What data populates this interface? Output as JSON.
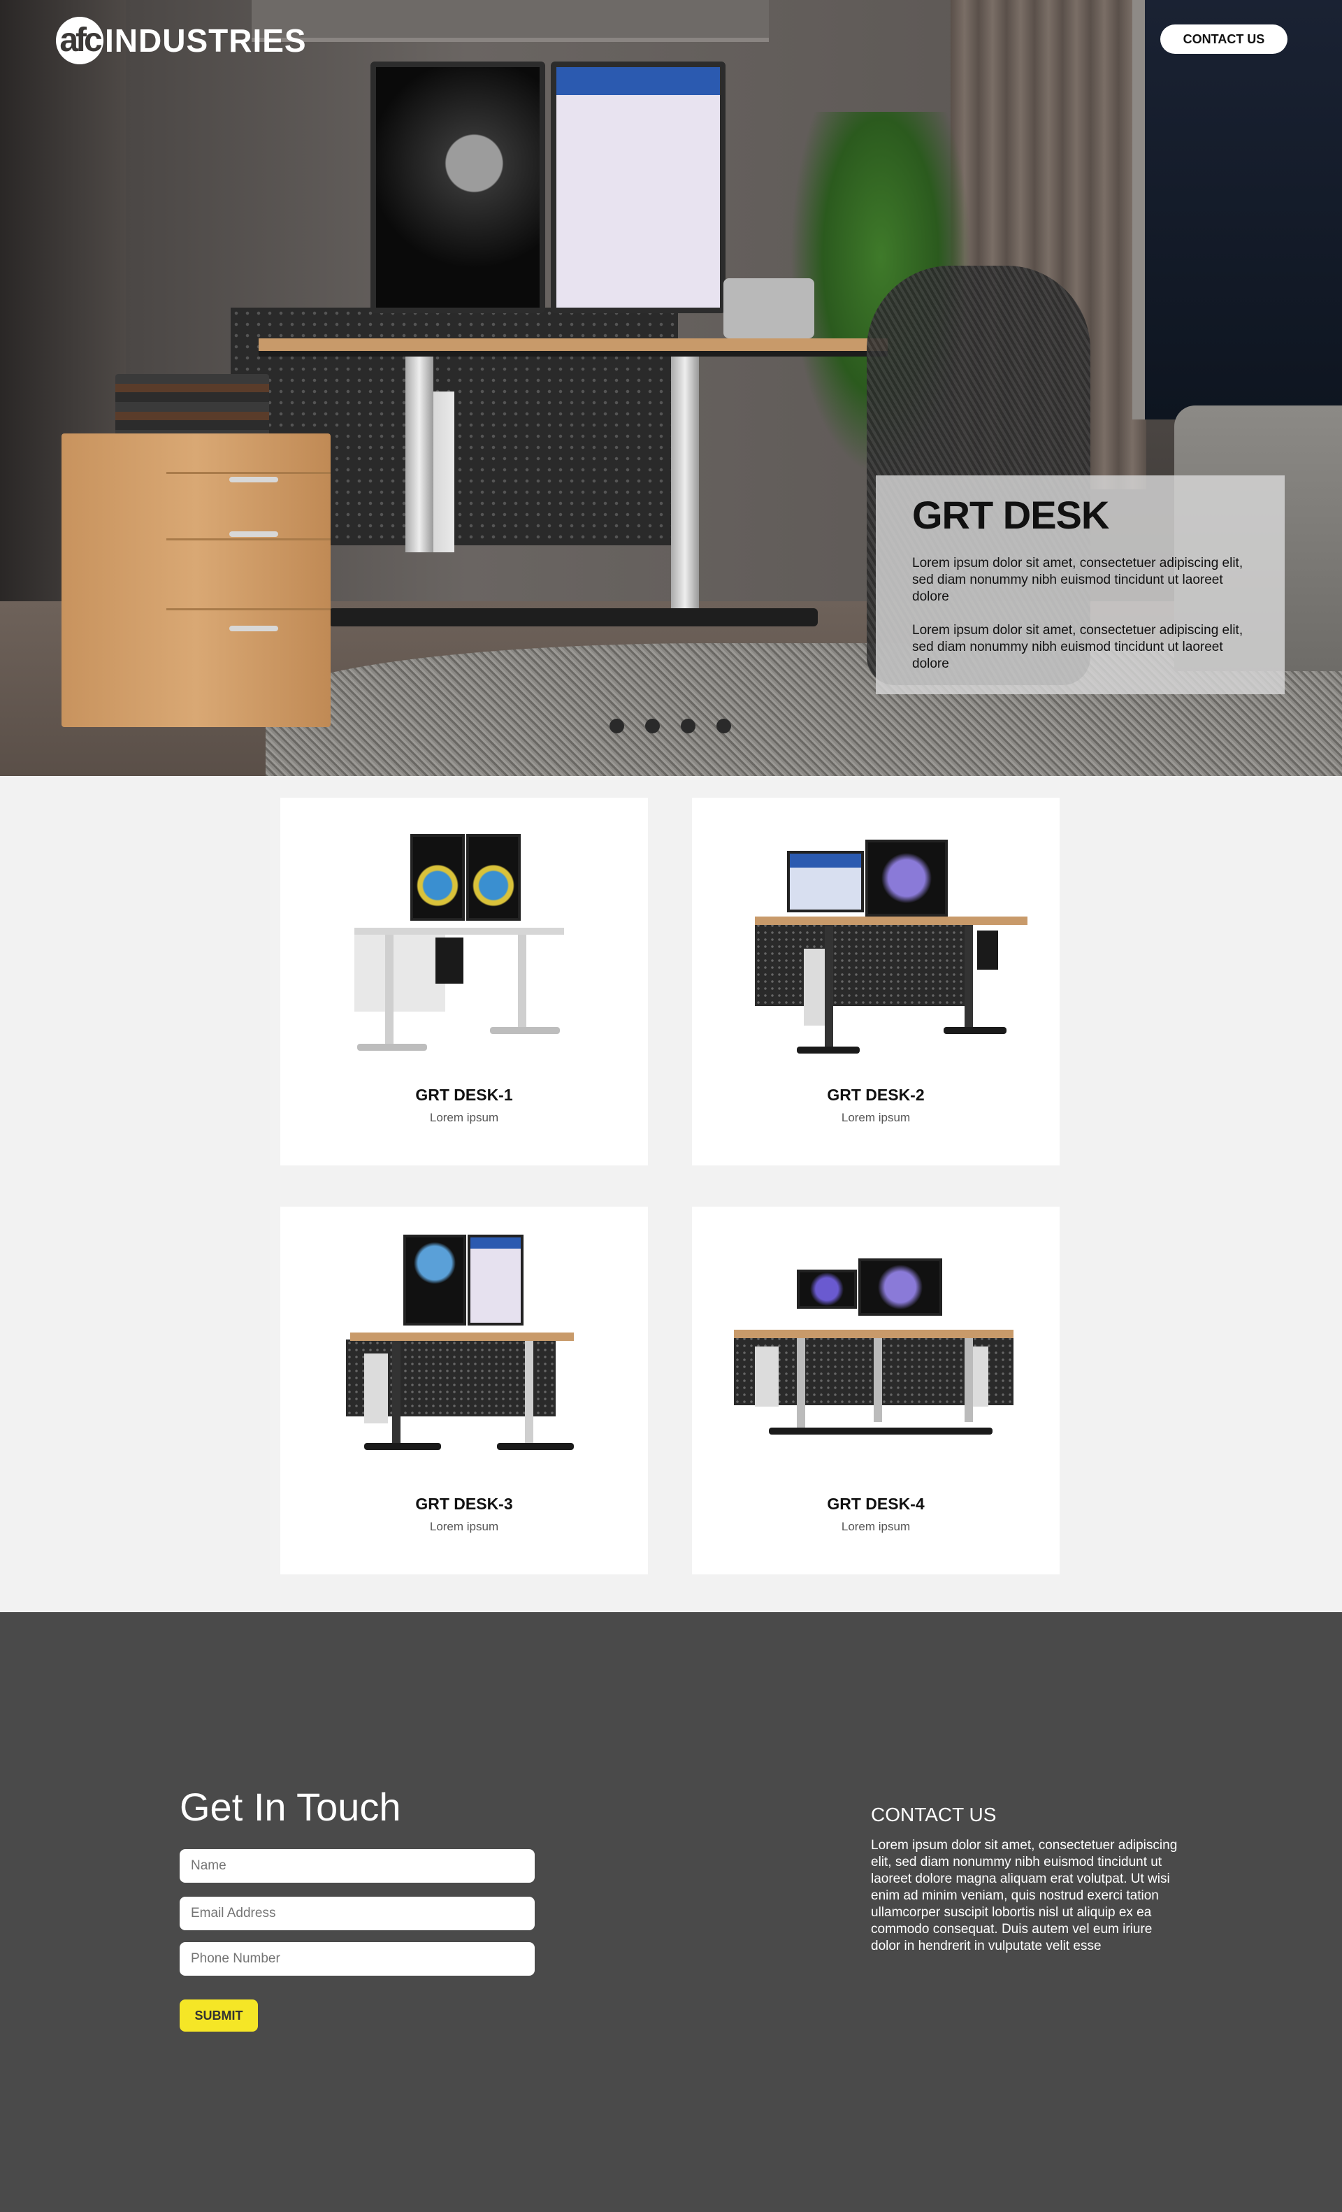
{
  "header": {
    "logo_mark": "afc",
    "logo_text": "INDUSTRIES",
    "contact_button": "CONTACT US"
  },
  "hero": {
    "title": "GRT DESK",
    "paragraphs": [
      "Lorem ipsum dolor sit amet, consectetuer adipiscing elit, sed diam nonummy nibh euismod tincidunt ut laoreet dolore",
      "Lorem ipsum dolor sit amet, consectetuer adipiscing elit, sed diam nonummy nibh euismod tincidunt ut laoreet dolore"
    ],
    "slide_count": 4
  },
  "products": [
    {
      "name": "GRT DESK-1",
      "subtitle": "Lorem ipsum"
    },
    {
      "name": "GRT DESK-2",
      "subtitle": "Lorem ipsum"
    },
    {
      "name": "GRT DESK-3",
      "subtitle": "Lorem ipsum"
    },
    {
      "name": "GRT DESK-4",
      "subtitle": "Lorem ipsum"
    }
  ],
  "contact": {
    "heading": "Get In Touch",
    "fields": {
      "name_placeholder": "Name",
      "email_placeholder": "Email Address",
      "phone_placeholder": "Phone Number"
    },
    "submit_label": "SUBMIT",
    "info_title": "CONTACT US",
    "info_text": "Lorem ipsum dolor sit amet, consectetuer adipiscing elit, sed diam nonummy nibh euismod tincidunt ut laoreet dolore magna aliquam erat volutpat. Ut wisi enim ad minim veniam, quis nostrud exerci tation ullamcorper suscipit lobortis nisl ut aliquip ex ea commodo consequat. Duis autem vel eum iriure dolor in hendrerit in vulputate velit esse"
  },
  "colors": {
    "accent": "#f5e626",
    "dark_bg": "#4a4a4a",
    "light_bg": "#f2f2f2"
  }
}
